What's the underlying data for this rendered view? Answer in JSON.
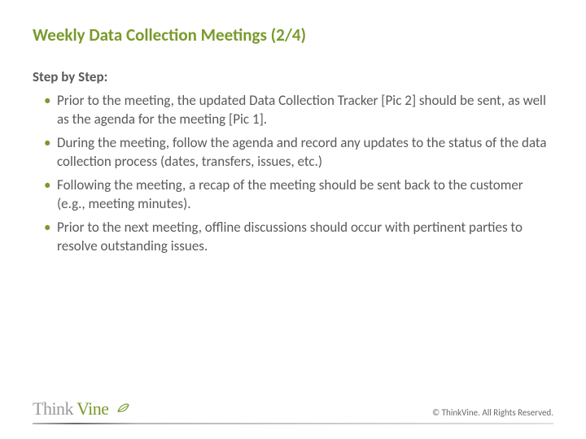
{
  "title": "Weekly Data Collection Meetings (2/4)",
  "subtitle": "Step by Step:",
  "bullets": [
    "Prior to the meeting, the updated Data Collection Tracker [Pic 2] should be sent, as well as the agenda for the meeting [Pic 1].",
    "During the meeting, follow the agenda and record any updates to the status of the data collection process (dates, transfers, issues, etc.)",
    "Following the meeting, a recap of the meeting should be sent back to the customer (e.g., meeting minutes).",
    "Prior to the next meeting, offline discussions should occur with pertinent parties to resolve outstanding issues."
  ],
  "logo": {
    "part1": "Think",
    "part2": "Vine"
  },
  "copyright": "© ThinkVine.  All Rights Reserved."
}
